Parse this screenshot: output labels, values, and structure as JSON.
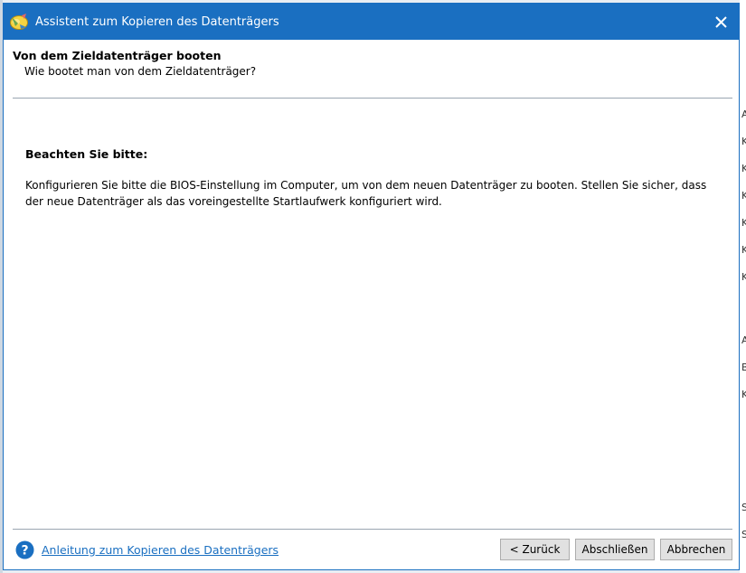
{
  "window": {
    "title": "Assistent zum Kopieren des Datenträgers"
  },
  "header": {
    "title": "Von dem Zieldatenträger booten",
    "subtitle": "Wie bootet man von dem Zieldatenträger?"
  },
  "content": {
    "note_label": "Beachten Sie bitte:",
    "note_text": "Konfigurieren Sie bitte die BIOS-Einstellung im Computer, um von dem neuen Datenträger zu booten. Stellen Sie sicher, dass der neue Datenträger als das voreingestellte Startlaufwerk konfiguriert wird."
  },
  "footer": {
    "help_link": "Anleitung zum Kopieren des Datenträgers",
    "back_label": "< Zurück",
    "finish_label": "Abschließen",
    "cancel_label": "Abbrechen"
  },
  "background_fragments": [
    "A",
    "K",
    "K",
    "K",
    "K",
    "K",
    "K",
    "A",
    "B",
    "K",
    "S",
    "S"
  ],
  "colors": {
    "titlebar": "#1a6fc1",
    "link": "#1a6fc1",
    "button_bg": "#e1e1e1"
  }
}
